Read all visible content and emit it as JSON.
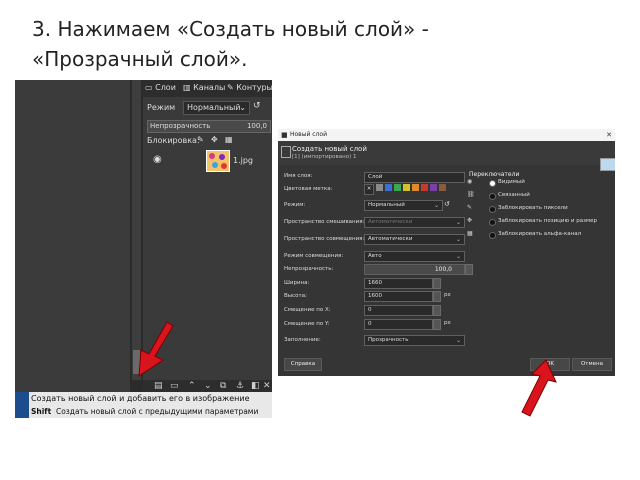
{
  "heading": {
    "line1": "3. Нажимаем «Создать новый слой» -",
    "line2": "«Прозрачный слой»."
  },
  "layers_panel": {
    "tabs": [
      "Слои",
      "Каналы",
      "Контуры"
    ],
    "mode_label": "Режим",
    "mode_value": "Нормальный",
    "opacity_label": "Непрозрачность",
    "opacity_value": "100,0",
    "lock_label": "Блокировка:",
    "layer_name": "1.jpg",
    "tooltip_line1": "Создать новый слой и добавить его в изображение",
    "tooltip_shift": "Shift",
    "tooltip_line2": "Создать новый слой с предыдущими параметрами"
  },
  "new_layer_dialog": {
    "window_title": "Новый слой",
    "header_title": "Создать новый слой",
    "header_subtitle": "[1] (импортировано) 1",
    "fields": {
      "name_label": "Имя слоя:",
      "name_value": "Слой",
      "color_tag_label": "Цветовая метка:",
      "mode_label": "Режим:",
      "mode_value": "Нормальный",
      "blend_label": "Пространство смешивания:",
      "blend_value": "Автоматически",
      "composite_space_label": "Пространство совмещения:",
      "composite_space_value": "Автоматически",
      "composite_mode_label": "Режим совмещения:",
      "composite_mode_value": "Авто",
      "opacity_label": "Непрозрачность:",
      "opacity_value": "100,0",
      "width_label": "Ширина:",
      "width_value": "1660",
      "height_label": "Высота:",
      "height_value": "1600",
      "offset_x_label": "Смещение по X:",
      "offset_x_value": "0",
      "offset_y_label": "Смещение по Y:",
      "offset_y_value": "0",
      "unit_value": "px",
      "fill_label": "Заполнение:",
      "fill_value": "Прозрачность"
    },
    "switches_title": "Переключатели",
    "switches": [
      "Видимый",
      "Связанный",
      "Заблокировать пиксели",
      "Заблокировать позицию и размер",
      "Заблокировать альфа-канал"
    ],
    "buttons": {
      "help": "Справка",
      "ok": "OK",
      "cancel": "Отмена"
    }
  },
  "colors": {
    "gimp_bg": "#353535",
    "arrow": "#d9141c",
    "color_tags": [
      "#8a8a8a",
      "#3b6fd4",
      "#3aa650",
      "#d3c22a",
      "#e08a2a",
      "#c23b2b",
      "#7b3fa8",
      "#8b5a3c"
    ]
  }
}
